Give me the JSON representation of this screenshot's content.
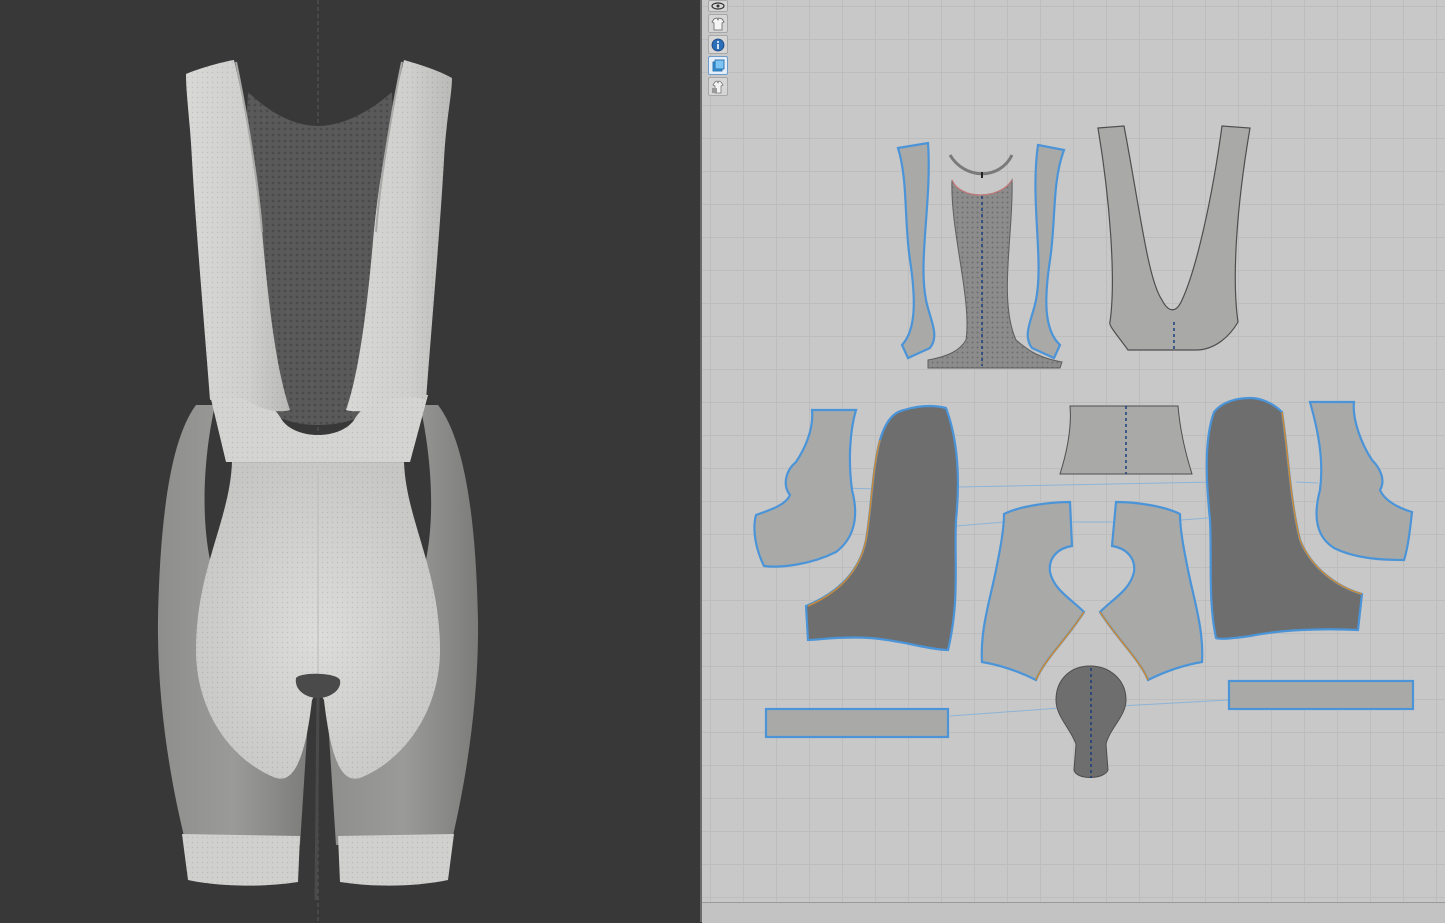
{
  "window": {
    "panels": [
      "3d-garment-view",
      "2d-pattern-view"
    ]
  },
  "toolbar_2d": {
    "tools": [
      {
        "name": "view-mode-icon",
        "active": false
      },
      {
        "name": "garment-icon",
        "active": false
      },
      {
        "name": "info-icon",
        "active": false
      },
      {
        "name": "texture-icon",
        "active": true
      },
      {
        "name": "lock-garment-icon",
        "active": false
      }
    ]
  },
  "colors": {
    "viewport_3d_bg": "#383838",
    "viewport_2d_bg": "#c8c8c8",
    "pattern_light": "#a9aaa8",
    "pattern_dark": "#6e6e6e",
    "pattern_outline": "#4b94d8",
    "seam_orange": "#c88a3a",
    "fabric_light": "#d2d3d1",
    "fabric_mid": "#8f908e",
    "fabric_mesh": "#606060"
  },
  "pattern_pieces": [
    "strap-left",
    "strap-right",
    "back-mesh-panel",
    "collar-binding",
    "bib-strap-yoke",
    "side-panel-left",
    "side-panel-right",
    "front-panel-left",
    "front-panel-right",
    "waist-band",
    "inner-leg-left",
    "inner-leg-right",
    "chamois-pad",
    "leg-gripper-left",
    "leg-gripper-right"
  ]
}
